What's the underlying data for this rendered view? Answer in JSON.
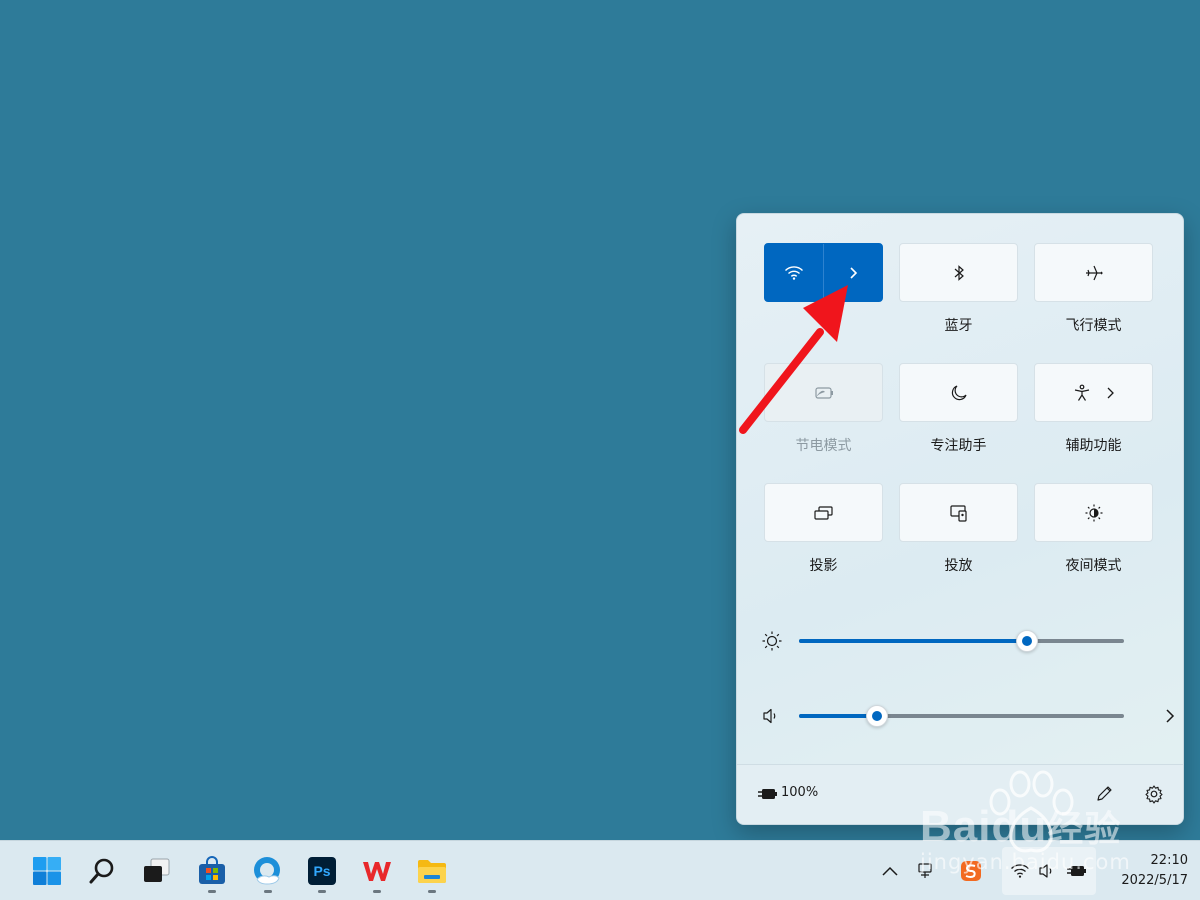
{
  "quick_settings": {
    "tiles": [
      {
        "id": "wifi",
        "label": "",
        "icon": "wifi-icon",
        "active": true
      },
      {
        "id": "bluetooth",
        "label": "蓝牙",
        "icon": "bluetooth-icon"
      },
      {
        "id": "airplane",
        "label": "飞行模式",
        "icon": "airplane-icon"
      },
      {
        "id": "battery_saver",
        "label": "节电模式",
        "icon": "battery-saver-icon",
        "disabled": true
      },
      {
        "id": "focus",
        "label": "专注助手",
        "icon": "moon-icon"
      },
      {
        "id": "accessibility",
        "label": "辅助功能",
        "icon": "accessibility-icon"
      },
      {
        "id": "project",
        "label": "投影",
        "icon": "project-icon"
      },
      {
        "id": "cast",
        "label": "投放",
        "icon": "cast-icon"
      },
      {
        "id": "night_light",
        "label": "夜间模式",
        "icon": "night-light-icon"
      }
    ],
    "brightness": {
      "value": 70,
      "icon": "sun-icon"
    },
    "volume": {
      "value": 24,
      "icon": "speaker-icon"
    },
    "footer": {
      "battery_text": "100%",
      "battery_icon": "battery-charging-icon",
      "edit_icon": "pencil-icon",
      "settings_icon": "gear-icon"
    }
  },
  "taskbar": {
    "apps": [
      {
        "name": "start",
        "icon": "windows-logo-icon"
      },
      {
        "name": "search",
        "icon": "search-icon"
      },
      {
        "name": "task-view",
        "icon": "task-view-icon"
      },
      {
        "name": "store",
        "icon": "store-icon",
        "running": true
      },
      {
        "name": "edge",
        "icon": "edge-icon",
        "running": true
      },
      {
        "name": "photoshop",
        "icon": "photoshop-icon",
        "running": true,
        "text": "Ps"
      },
      {
        "name": "wps",
        "icon": "wps-icon",
        "running": true
      },
      {
        "name": "explorer",
        "icon": "folder-icon",
        "running": true
      }
    ],
    "tray": {
      "time": "22:10",
      "date": "2022/5/17"
    }
  },
  "watermark": {
    "brand": "Baidu",
    "brand_cn": "经验",
    "url": "jingyan.baidu.com"
  },
  "colors": {
    "accent": "#0067c0",
    "desktop": "#2e7b99",
    "arrow": "#f0151c"
  }
}
